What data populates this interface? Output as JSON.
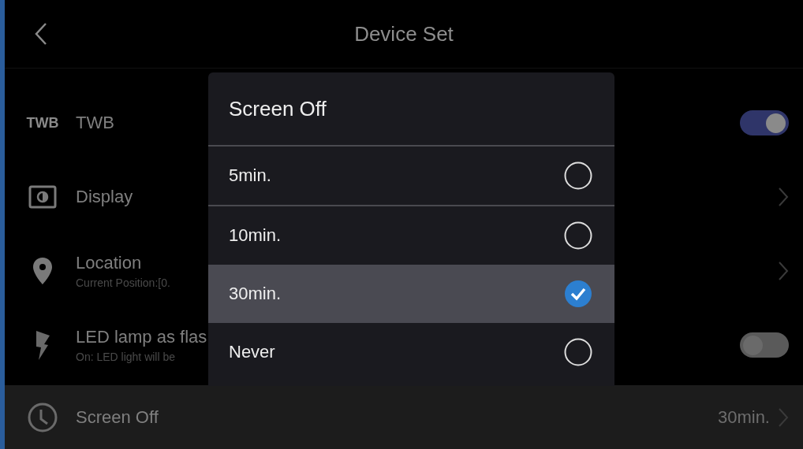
{
  "header": {
    "title": "Device Set"
  },
  "settings": [
    {
      "kind": "toggle",
      "icon_text": "TWB",
      "label": "TWB",
      "on": true,
      "selected": false
    },
    {
      "kind": "link",
      "label": "Display",
      "selected": false
    },
    {
      "kind": "link",
      "label": "Location",
      "subtitle": "Current Position:[0.",
      "selected": false
    },
    {
      "kind": "toggle",
      "label": "LED lamp as flas",
      "subtitle": "On: LED light will be",
      "on": false,
      "selected": false
    },
    {
      "kind": "link",
      "label": "Screen Off",
      "value": "30min.",
      "selected": true
    }
  ],
  "dialog": {
    "title": "Screen Off",
    "options": [
      {
        "label": "5min.",
        "selected": false
      },
      {
        "label": "10min.",
        "selected": false
      },
      {
        "label": "30min.",
        "selected": true
      },
      {
        "label": "Never",
        "selected": false
      }
    ]
  }
}
